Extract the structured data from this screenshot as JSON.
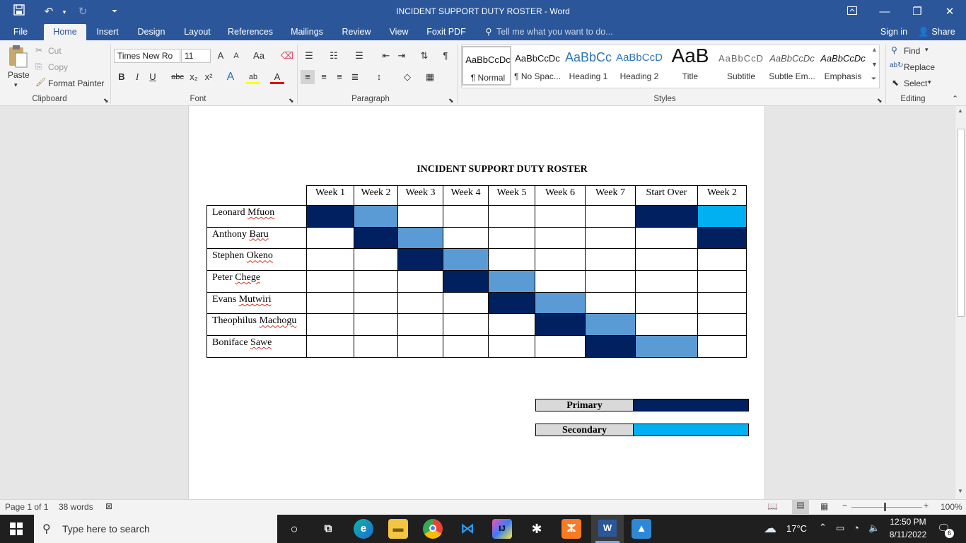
{
  "window": {
    "title": "INCIDENT SUPPORT DUTY ROSTER - Word"
  },
  "quick_access": {
    "save_icon": "save-icon",
    "undo_icon": "undo-icon",
    "redo_icon": "redo-icon",
    "customize_icon": "customize-icon"
  },
  "tabs": [
    {
      "label": "File"
    },
    {
      "label": "Home"
    },
    {
      "label": "Insert"
    },
    {
      "label": "Design"
    },
    {
      "label": "Layout"
    },
    {
      "label": "References"
    },
    {
      "label": "Mailings"
    },
    {
      "label": "Review"
    },
    {
      "label": "View"
    },
    {
      "label": "Foxit PDF"
    }
  ],
  "tell_me": "Tell me what you want to do...",
  "sign_in": "Sign in",
  "share": "Share",
  "clipboard": {
    "paste": "Paste",
    "cut": "Cut",
    "copy": "Copy",
    "format_painter": "Format Painter",
    "label": "Clipboard"
  },
  "font": {
    "name": "Times New Ro",
    "size": "11",
    "label": "Font",
    "bold": "B",
    "italic": "I",
    "underline": "U",
    "strike": "abc",
    "sub": "x₂",
    "sup": "x²",
    "grow": "A",
    "shrink": "A",
    "case": "Aa"
  },
  "paragraph": {
    "label": "Paragraph"
  },
  "styles": {
    "label": "Styles",
    "items": [
      {
        "sample": "AaBbCcDc",
        "name": "¶ Normal"
      },
      {
        "sample": "AaBbCcDc",
        "name": "¶ No Spac..."
      },
      {
        "sample": "AaBbCc",
        "name": "Heading 1"
      },
      {
        "sample": "AaBbCcD",
        "name": "Heading 2"
      },
      {
        "sample": "AaB",
        "name": "Title"
      },
      {
        "sample": "AaBbCcD",
        "name": "Subtitle"
      },
      {
        "sample": "AaBbCcDc",
        "name": "Subtle Em..."
      },
      {
        "sample": "AaBbCcDc",
        "name": "Emphasis"
      }
    ]
  },
  "editing": {
    "find": "Find",
    "replace": "Replace",
    "select": "Select",
    "label": "Editing"
  },
  "document": {
    "title": "INCIDENT SUPPORT DUTY ROSTER",
    "columns": [
      "Week 1",
      "Week 2",
      "Week 3",
      "Week 4",
      "Week 5",
      "Week 6",
      "Week 7",
      "Start Over",
      "Week 2"
    ],
    "rows": [
      {
        "name": "Leonard Mfuon",
        "cells": [
          "P",
          "S",
          "",
          "",
          "",
          "",
          "",
          "P",
          "C"
        ]
      },
      {
        "name": "Anthony Baru",
        "cells": [
          "",
          "P",
          "S",
          "",
          "",
          "",
          "",
          "",
          "P"
        ]
      },
      {
        "name": "Stephen Okeno",
        "cells": [
          "",
          "",
          "P",
          "S",
          "",
          "",
          "",
          "",
          ""
        ]
      },
      {
        "name": "Peter Chege",
        "cells": [
          "",
          "",
          "",
          "P",
          "S",
          "",
          "",
          "",
          ""
        ]
      },
      {
        "name": "Evans Mutwiri",
        "cells": [
          "",
          "",
          "",
          "",
          "P",
          "S",
          "",
          "",
          ""
        ]
      },
      {
        "name": "Theophilus Machogu",
        "cells": [
          "",
          "",
          "",
          "",
          "",
          "P",
          "S",
          "",
          ""
        ]
      },
      {
        "name": "Boniface Sawe",
        "cells": [
          "",
          "",
          "",
          "",
          "",
          "",
          "P",
          "S",
          ""
        ]
      }
    ],
    "legend": [
      {
        "label": "Primary",
        "color": "#002060"
      },
      {
        "label": "Secondary",
        "color": "#00b0f0"
      }
    ],
    "colors": {
      "primary": "#002060",
      "secondary": "#5b9bd5",
      "bright": "#00b0f0"
    }
  },
  "status": {
    "page": "Page 1 of 1",
    "words": "38 words",
    "zoom": "100%"
  },
  "taskbar": {
    "search_placeholder": "Type here to search",
    "weather": "17°C",
    "time": "12:50 PM",
    "date": "8/11/2022",
    "notifications": "6"
  }
}
